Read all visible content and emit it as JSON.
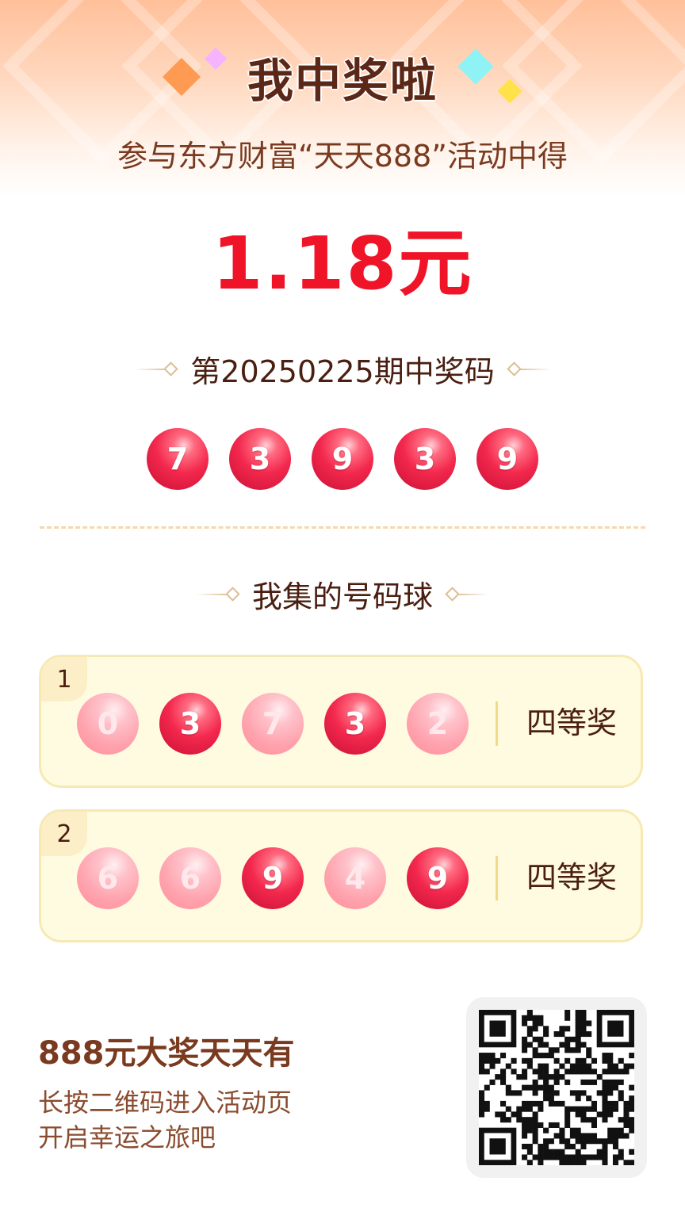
{
  "header": {
    "title": "我中奖啦"
  },
  "subtitle": "参与东方财富“天天888”活动中得",
  "amount": "1.18元",
  "winning": {
    "heading": "第20250225期中奖码",
    "numbers": [
      "7",
      "3",
      "9",
      "3",
      "9"
    ]
  },
  "collected": {
    "heading": "我集的号码球",
    "tickets": [
      {
        "index": "1",
        "balls": [
          {
            "n": "0",
            "hit": false
          },
          {
            "n": "3",
            "hit": true
          },
          {
            "n": "7",
            "hit": false
          },
          {
            "n": "3",
            "hit": true
          },
          {
            "n": "2",
            "hit": false
          }
        ],
        "prize": "四等奖"
      },
      {
        "index": "2",
        "balls": [
          {
            "n": "6",
            "hit": false
          },
          {
            "n": "6",
            "hit": false
          },
          {
            "n": "9",
            "hit": true
          },
          {
            "n": "4",
            "hit": false
          },
          {
            "n": "9",
            "hit": true
          }
        ],
        "prize": "四等奖"
      }
    ]
  },
  "promo": {
    "title": "888元大奖天天有",
    "line1": "长按二维码进入活动页",
    "line2": "开启幸运之旅吧"
  },
  "colors": {
    "accent_red": "#f01428",
    "brown_text": "#4a1e10",
    "ticket_bg": "#fffbe0"
  },
  "icons": {
    "qr": "qr-code-icon"
  }
}
